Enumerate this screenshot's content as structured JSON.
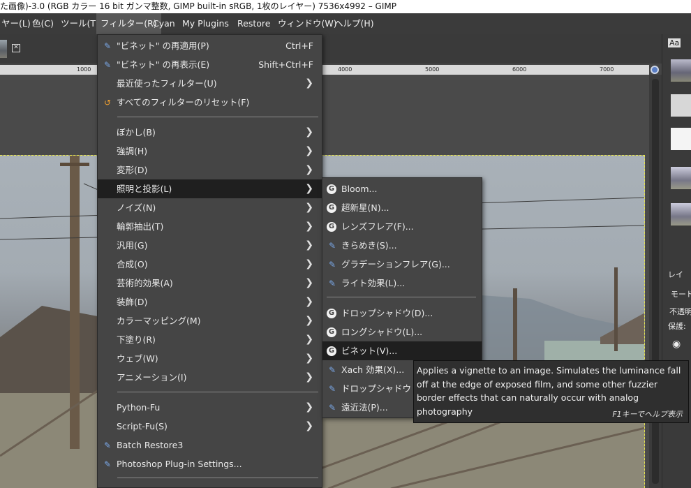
{
  "window": {
    "title": "た画像)-3.0 (RGB カラー 16 bit ガンマ整数, GIMP built-in sRGB, 1枚のレイヤー) 7536x4992 – GIMP"
  },
  "menubar": {
    "items": [
      "ヤー(L)",
      "色(C)",
      "ツール(T)",
      "フィルター(R)",
      "Cyan",
      "My Plugins",
      "Restore",
      "ウィンドウ(W)",
      "ヘルプ(H)"
    ]
  },
  "tabs": {
    "close_glyph": "✕"
  },
  "ruler": {
    "ticks": [
      "1000",
      "4000",
      "5000",
      "6000",
      "7000"
    ]
  },
  "filters_menu": {
    "top_items": [
      {
        "label": "\"ビネット\" の再適用(P)",
        "shortcut": "Ctrl+F",
        "icon": "plugin-icon"
      },
      {
        "label": "\"ビネット\" の再表示(E)",
        "shortcut": "Shift+Ctrl+F",
        "icon": "plugin-icon"
      },
      {
        "label": "最近使ったフィルター(U)",
        "icon": "none"
      },
      {
        "label": "すべてのフィルターのリセット(F)",
        "icon": "reset-icon"
      }
    ],
    "category_items": [
      {
        "label": "ぼかし(B)"
      },
      {
        "label": "強調(H)"
      },
      {
        "label": "変形(D)"
      },
      {
        "label": "照明と投影(L)"
      },
      {
        "label": "ノイズ(N)"
      },
      {
        "label": "輪郭抽出(T)"
      },
      {
        "label": "汎用(G)"
      },
      {
        "label": "合成(O)"
      },
      {
        "label": "芸術的効果(A)"
      },
      {
        "label": "装飾(D)"
      },
      {
        "label": "カラーマッピング(M)"
      },
      {
        "label": "下塗り(R)"
      },
      {
        "label": "ウェブ(W)"
      },
      {
        "label": "アニメーション(I)"
      }
    ],
    "script_items": [
      {
        "label": "Python-Fu"
      },
      {
        "label": "Script-Fu(S)"
      }
    ],
    "plugin_items": [
      {
        "label": "Batch Restore3"
      },
      {
        "label": "Photoshop Plug-in Settings..."
      }
    ],
    "highlighted": "照明と投影(L)"
  },
  "submenu": {
    "group1": [
      {
        "label": "Bloom...",
        "icon": "gegl-icon"
      },
      {
        "label": "超新星(N)...",
        "icon": "gegl-icon"
      },
      {
        "label": "レンズフレア(F)...",
        "icon": "gegl-icon"
      },
      {
        "label": "きらめき(S)...",
        "icon": "plugin-icon"
      },
      {
        "label": "グラデーションフレア(G)...",
        "icon": "plugin-icon"
      },
      {
        "label": "ライト効果(L)...",
        "icon": "plugin-icon"
      }
    ],
    "group2": [
      {
        "label": "ドロップシャドウ(D)...",
        "icon": "gegl-icon"
      },
      {
        "label": "ロングシャドウ(L)...",
        "icon": "gegl-icon"
      },
      {
        "label": "ビネット(V)...",
        "icon": "gegl-icon"
      },
      {
        "label": "Xach 効果(X)...",
        "icon": "plugin-icon"
      },
      {
        "label": "ドロップシャドウ (レガ",
        "icon": "plugin-icon"
      },
      {
        "label": "遠近法(P)...",
        "icon": "plugin-icon"
      }
    ],
    "highlighted": "ビネット(V)..."
  },
  "tooltip": {
    "text": "Applies a vignette to an image. Simulates the luminance fall off at the edge of exposed film, and some other fuzzier border effects that can naturally occur with analog photography",
    "hint": "F1キーでヘルプ表示"
  },
  "right_panel": {
    "tab_label": "Aa",
    "layers_label": "レイ",
    "mode_label": "モード",
    "opacity_label": "不透明",
    "lock_label": "保護:"
  }
}
